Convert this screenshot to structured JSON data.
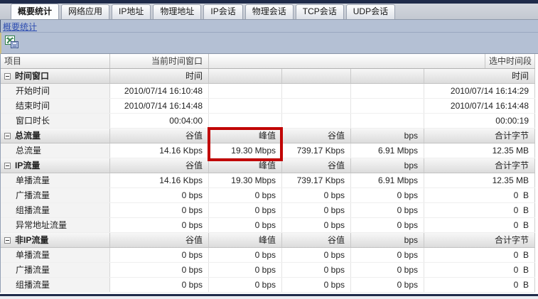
{
  "colors": {
    "accent_navy": "#1f2b4a",
    "bar_bg": "#b4c0d4",
    "link_blue": "#2b4bb0",
    "highlight_red": "#c10303"
  },
  "tabs": [
    {
      "name": "tab-summary-stats",
      "label": "概要统计",
      "active": true
    },
    {
      "name": "tab-network-apps",
      "label": "网络应用",
      "active": false
    },
    {
      "name": "tab-ip-address",
      "label": "IP地址",
      "active": false
    },
    {
      "name": "tab-physical-address",
      "label": "物理地址",
      "active": false
    },
    {
      "name": "tab-ip-session",
      "label": "IP会话",
      "active": false
    },
    {
      "name": "tab-physical-session",
      "label": "物理会话",
      "active": false
    },
    {
      "name": "tab-tcp-session",
      "label": "TCP会话",
      "active": false
    },
    {
      "name": "tab-udp-session",
      "label": "UDP会话",
      "active": false
    }
  ],
  "breadcrumb": {
    "link_label": "概要统计"
  },
  "toolbar": {
    "icons": [
      {
        "name": "export-to-excel-icon"
      }
    ]
  },
  "table": {
    "columns": {
      "item": "项目",
      "current_window": "当前时间窗口",
      "selected_range": "选中时间段"
    },
    "rows": [
      {
        "type": "group",
        "label": "时间窗口",
        "values": [
          "时间",
          "",
          "",
          "",
          "时间"
        ]
      },
      {
        "type": "data",
        "label": "开始时间",
        "values": [
          "2010/07/14 16:10:48",
          "",
          "",
          "",
          "2010/07/14 16:14:29"
        ]
      },
      {
        "type": "data",
        "label": "结束时间",
        "values": [
          "2010/07/14 16:14:48",
          "",
          "",
          "",
          "2010/07/14 16:14:48"
        ]
      },
      {
        "type": "data",
        "label": "窗口时长",
        "values": [
          "00:04:00",
          "",
          "",
          "",
          "00:00:19"
        ]
      },
      {
        "type": "group",
        "label": "总流量",
        "values": [
          "谷值",
          "峰值",
          "谷值",
          "bps",
          "合计字节"
        ]
      },
      {
        "type": "data",
        "label": "总流量",
        "values": [
          "14.16 Kbps",
          "19.30 Mbps",
          "739.17 Kbps",
          "6.91 Mbps",
          "12.35 MB"
        ]
      },
      {
        "type": "group",
        "label": "IP流量",
        "values": [
          "谷值",
          "峰值",
          "谷值",
          "bps",
          "合计字节"
        ]
      },
      {
        "type": "data",
        "label": "单播流量",
        "values": [
          "14.16 Kbps",
          "19.30 Mbps",
          "739.17 Kbps",
          "6.91 Mbps",
          "12.35 MB"
        ]
      },
      {
        "type": "data",
        "label": "广播流量",
        "values": [
          "0 bps",
          "0 bps",
          "0 bps",
          "0 bps",
          "0  B"
        ]
      },
      {
        "type": "data",
        "label": "组播流量",
        "values": [
          "0 bps",
          "0 bps",
          "0 bps",
          "0 bps",
          "0  B"
        ]
      },
      {
        "type": "data",
        "label": "异常地址流量",
        "values": [
          "0 bps",
          "0 bps",
          "0 bps",
          "0 bps",
          "0  B"
        ]
      },
      {
        "type": "group",
        "label": "非IP流量",
        "values": [
          "谷值",
          "峰值",
          "谷值",
          "bps",
          "合计字节"
        ]
      },
      {
        "type": "data",
        "label": "单播流量",
        "values": [
          "0 bps",
          "0 bps",
          "0 bps",
          "0 bps",
          "0  B"
        ]
      },
      {
        "type": "data",
        "label": "广播流量",
        "values": [
          "0 bps",
          "0 bps",
          "0 bps",
          "0 bps",
          "0  B"
        ]
      },
      {
        "type": "data",
        "label": "组播流量",
        "values": [
          "0 bps",
          "0 bps",
          "0 bps",
          "0 bps",
          "0  B"
        ]
      }
    ]
  },
  "highlight": {
    "name": "peak-value-highlight",
    "color": "#c10303"
  }
}
